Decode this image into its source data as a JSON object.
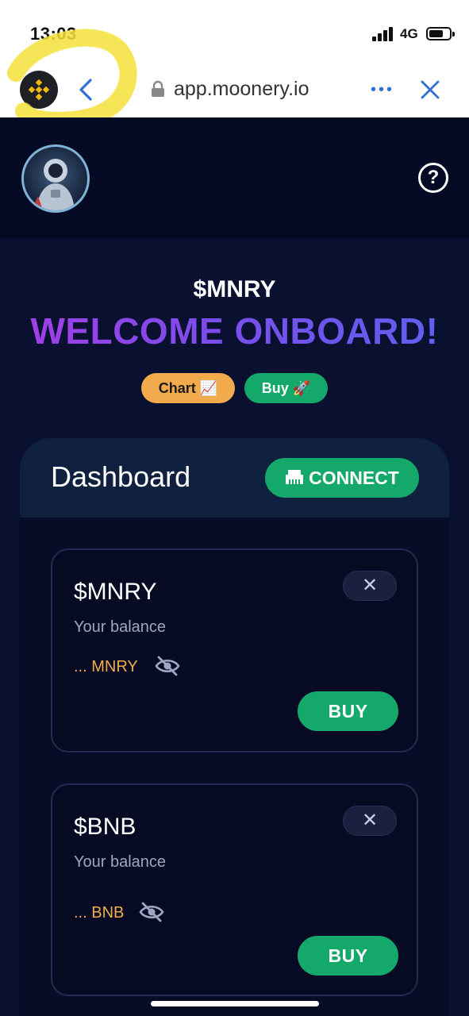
{
  "status_bar": {
    "time": "13:03",
    "network": "4G"
  },
  "browser": {
    "url": "app.moonery.io",
    "more_label": "•••"
  },
  "header": {
    "help_label": "?"
  },
  "hero": {
    "ticker": "$MNRY",
    "title": "WELCOME ONBOARD!",
    "chart_label": "Chart 📈",
    "buy_label": "Buy 🚀"
  },
  "dashboard": {
    "title": "Dashboard",
    "connect_label": "CONNECT",
    "cards": [
      {
        "token": "$MNRY",
        "balance_label": "Your balance",
        "balance_value": "... MNRY",
        "dismiss_label": "✕",
        "buy_label": "BUY"
      },
      {
        "token": "$BNB",
        "balance_label": "Your balance",
        "balance_value": "... BNB",
        "dismiss_label": "✕",
        "buy_label": "BUY"
      }
    ]
  },
  "colors": {
    "accent_green": "#14a96a",
    "accent_orange": "#f1aa4c",
    "background": "#0a1030"
  }
}
